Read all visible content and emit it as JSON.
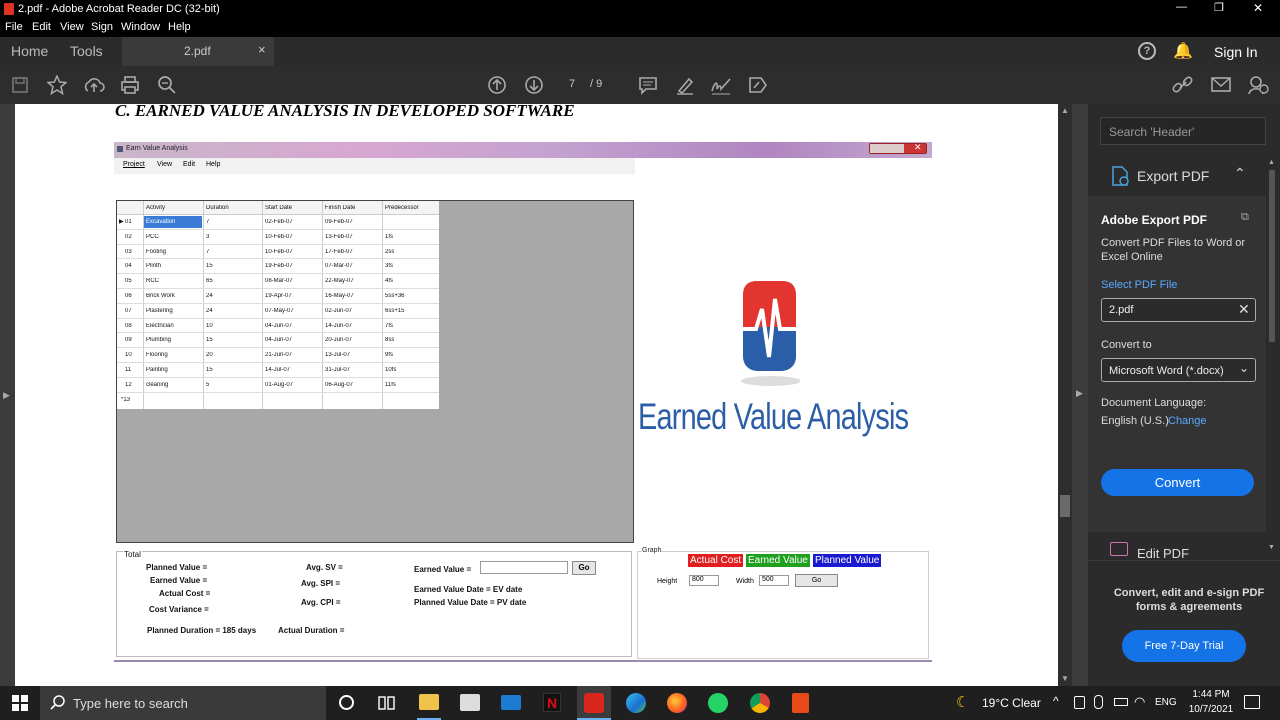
{
  "window": {
    "title": "2.pdf - Adobe Acrobat Reader DC (32-bit)",
    "controls": [
      "—",
      "❐",
      "✕"
    ]
  },
  "menu": [
    "File",
    "Edit",
    "View",
    "Sign",
    "Window",
    "Help"
  ],
  "tabs": {
    "home": "Home",
    "tools": "Tools",
    "doc": "2.pdf",
    "close": "×"
  },
  "header": {
    "help": "?",
    "signin": "Sign In"
  },
  "nav": {
    "current": "7",
    "total": "/ 9"
  },
  "doc": {
    "heading": "C.  EARNED VALUE ANALYSIS IN DEVELOPED SOFTWARE",
    "app_title": "Earn Value Analysis",
    "app_menu": [
      "Project",
      "View",
      "Edit",
      "Help"
    ],
    "grid_headers": [
      "Activity",
      "Duration",
      "Start Date",
      "Finish Date",
      "Predecessor"
    ],
    "grid_rows": [
      [
        "01",
        "Excavation",
        "7",
        "02-Feb-07",
        "09-Feb-07",
        ""
      ],
      [
        "02",
        "PCC",
        "3",
        "10-Feb-07",
        "13-Feb-07",
        "1fs"
      ],
      [
        "03",
        "Footing",
        "7",
        "10-Feb-07",
        "17-Feb-07",
        "2ss"
      ],
      [
        "04",
        "Plinth",
        "15",
        "19-Feb-07",
        "07-Mar-07",
        "3fs"
      ],
      [
        "05",
        "RCC",
        "65",
        "08-Mar-07",
        "22-May-07",
        "4fs"
      ],
      [
        "06",
        "Brick Work",
        "24",
        "19-Apr-07",
        "16-May-07",
        "5ss+36"
      ],
      [
        "07",
        "Plastering",
        "24",
        "07-May-07",
        "02-Jun-07",
        "6ss+15"
      ],
      [
        "08",
        "Electrician",
        "10",
        "04-Jun-07",
        "14-Jun-07",
        "7fs"
      ],
      [
        "09",
        "Plumbing",
        "15",
        "04-Jun-07",
        "20-Jun-07",
        "8ss"
      ],
      [
        "10",
        "Flooring",
        "20",
        "21-Jun-07",
        "13-Jul-07",
        "9fs"
      ],
      [
        "11",
        "Painting",
        "15",
        "14-Jul-07",
        "31-Jul-07",
        "10fs"
      ],
      [
        "12",
        "cleaning",
        "5",
        "01-Aug-07",
        "06-Aug-07",
        "11fs"
      ]
    ],
    "new_row": "*13",
    "logo_text": "Earned Value Analysis",
    "total": {
      "group": "Total",
      "pv": "Planned Value =",
      "ev": "Earned Value =",
      "ac": "Actual Cost =",
      "cv": "Cost Variance =",
      "sv": "Avg. SV =",
      "spi": "Avg. SPI =",
      "cpi": "Avg. CPI =",
      "earned": "Earned Value =",
      "go": "Go",
      "evdate": "Earned Value Date =   EV date",
      "pvdate": "Planned Value Date =  PV date",
      "pdur": "Planned Duration  = 185  days",
      "adur": "Actual Duration  ="
    },
    "graph": {
      "group": "Graph",
      "actual": "Actual Cost",
      "earned": "Earned Value",
      "planned": "Planned Value",
      "height_label": "Height",
      "height": "800",
      "width_label": "Width",
      "width": "500",
      "go": "Go"
    }
  },
  "pane": {
    "search_placeholder": "Search 'Header'",
    "export": "Export PDF",
    "ae_title": "Adobe Export PDF",
    "ae_desc": "Convert PDF Files to Word or Excel Online",
    "select": "Select PDF File",
    "file": "2.pdf",
    "convert_to": "Convert to",
    "format": "Microsoft Word (*.docx)",
    "lang_label": "Document Language:",
    "lang": "English (U.S.)",
    "change": "Change",
    "convert": "Convert",
    "edit": "Edit PDF",
    "promo": "Convert, edit and e-sign PDF forms & agreements",
    "trial": "Free 7-Day Trial"
  },
  "taskbar": {
    "search": "Type here to search",
    "weather": "19°C  Clear",
    "lang": "ENG",
    "time": "1:44 PM",
    "date": "10/7/2021"
  },
  "colors": {
    "accent": "#1473e6",
    "actual": "#e02020",
    "earned": "#1fa01f",
    "planned": "#1a1ad0"
  }
}
